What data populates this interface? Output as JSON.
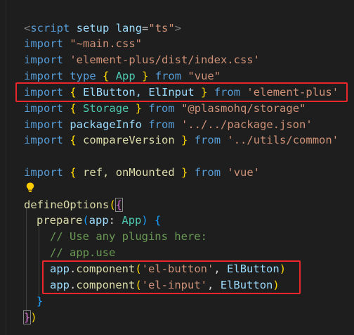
{
  "code": {
    "line1": {
      "open": "<",
      "tag": "script",
      "attr1": "setup",
      "attr2": "lang",
      "eq": "=",
      "val": "\"ts\"",
      "close": ">"
    },
    "line2": {
      "kw": "import",
      "str": "\"~main.css\""
    },
    "line3": {
      "kw": "import",
      "str": "'element-plus/dist/index.css'"
    },
    "line4": {
      "kw": "import",
      "type_kw": "type",
      "ob": "{",
      "name": "App",
      "cb": "}",
      "from": "from",
      "str": "\"vue\""
    },
    "line5": {
      "kw": "import",
      "ob": "{",
      "names": "ElButton, ElInput",
      "cb": "}",
      "from": "from",
      "str": "'element-plus'"
    },
    "line6": {
      "kw": "import",
      "ob": "{",
      "name": "Storage",
      "cb": "}",
      "from": "from",
      "str": "\"@plasmohq/storage\""
    },
    "line7": {
      "kw": "import",
      "name": "packageInfo",
      "from": "from",
      "str": "'../../package.json'"
    },
    "line8": {
      "kw": "import",
      "ob": "{",
      "name": "compareVersion",
      "cb": "}",
      "from": "from",
      "str": "'../utils/common'"
    },
    "line10": {
      "kw": "import",
      "ob": "{",
      "names": "ref, onMounted",
      "cb": "}",
      "from": "from",
      "str": "'vue'"
    },
    "line12": {
      "fn": "defineOptions",
      "op": "(",
      "ob": "{"
    },
    "line13": {
      "fn": "prepare",
      "op": "(",
      "param": "app",
      "colon": ":",
      "type": "App",
      "cp": ")",
      "ob": "{"
    },
    "line14": {
      "comment": "// Use any plugins here:"
    },
    "line15": {
      "comment": "// app.use"
    },
    "line16": {
      "obj": "app",
      "dot": ".",
      "fn": "component",
      "op": "(",
      "str": "'el-button'",
      "comma": ",",
      "arg": "ElButton",
      "cp": ")"
    },
    "line17": {
      "obj": "app",
      "dot": ".",
      "fn": "component",
      "op": "(",
      "str": "'el-input'",
      "comma": ",",
      "arg": "ElButton",
      "cp": ")"
    },
    "line18": {
      "cb": "}"
    },
    "line19": {
      "cb": "}",
      "cp": ")"
    }
  },
  "colors": {
    "background": "#1e1e1e",
    "keyword": "#569cd6",
    "string": "#ce9178",
    "comment": "#6a9955",
    "function": "#dcdcaa",
    "highlight_box": "#e8262c"
  },
  "icons": {
    "lightbulb": "lightbulb-icon"
  }
}
